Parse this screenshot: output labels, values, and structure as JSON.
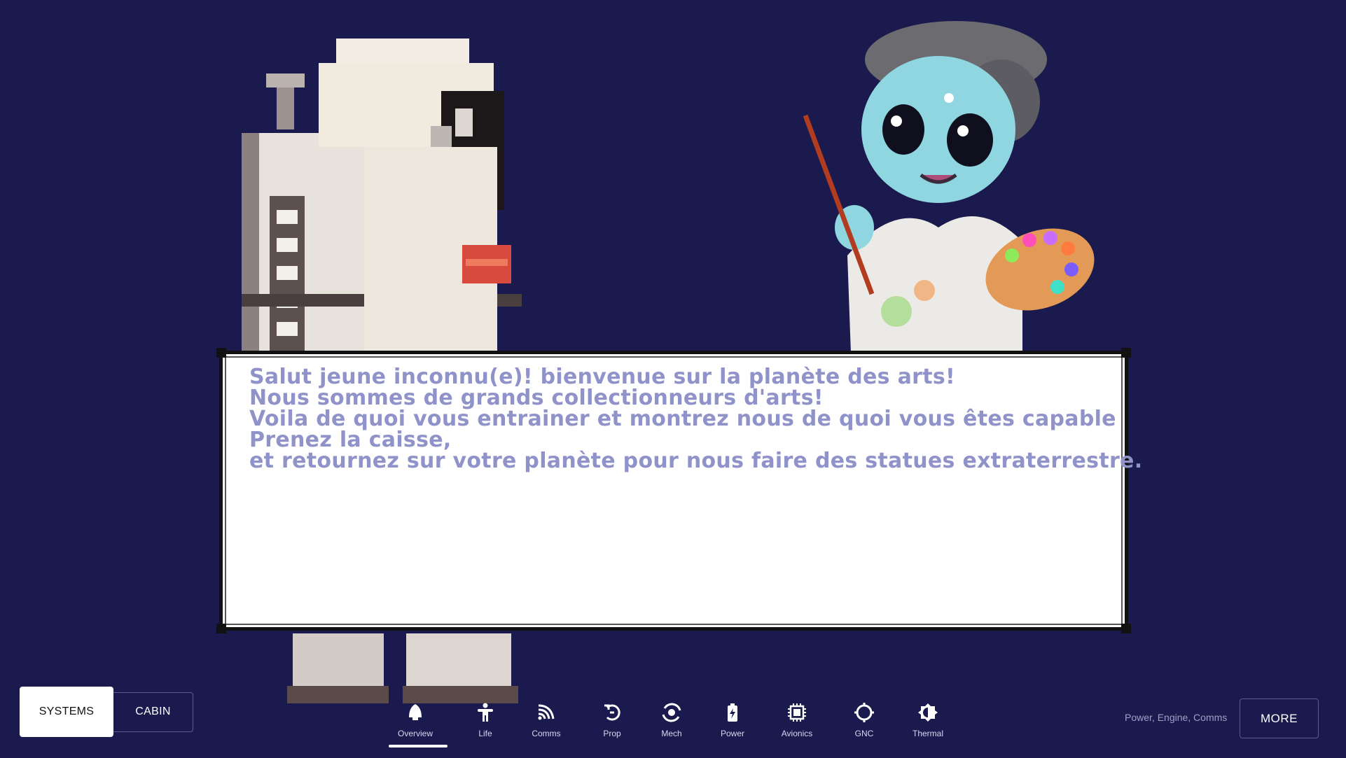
{
  "dialog": {
    "lines": [
      "Salut jeune inconnu(e)! bienvenue sur la planète des arts!",
      "Nous sommes de grands collectionneurs d'arts!",
      "Voila de quoi vous entrainer et montrez nous de quoi vous êtes capable",
      "Prenez la caisse,",
      "et retournez sur votre planète pour nous faire des statues extraterrestre."
    ]
  },
  "toggle": {
    "systems_label": "SYSTEMS",
    "cabin_label": "CABIN",
    "active": "SYSTEMS"
  },
  "nav": {
    "active": "Overview",
    "items": [
      {
        "label": "Overview",
        "icon": "rocket-icon"
      },
      {
        "label": "Life",
        "icon": "person-icon"
      },
      {
        "label": "Comms",
        "icon": "signal-icon"
      },
      {
        "label": "Prop",
        "icon": "propulsion-icon"
      },
      {
        "label": "Mech",
        "icon": "orbit-icon"
      },
      {
        "label": "Power",
        "icon": "battery-icon"
      },
      {
        "label": "Avionics",
        "icon": "chip-icon"
      },
      {
        "label": "GNC",
        "icon": "target-icon"
      },
      {
        "label": "Thermal",
        "icon": "thermal-icon"
      }
    ]
  },
  "status": {
    "summary": "Power, Engine, Comms"
  },
  "more": {
    "label": "MORE"
  },
  "colors": {
    "background": "#1a1a4e",
    "dialog_text": "#8f93c9",
    "dialog_bg": "#ffffff"
  }
}
